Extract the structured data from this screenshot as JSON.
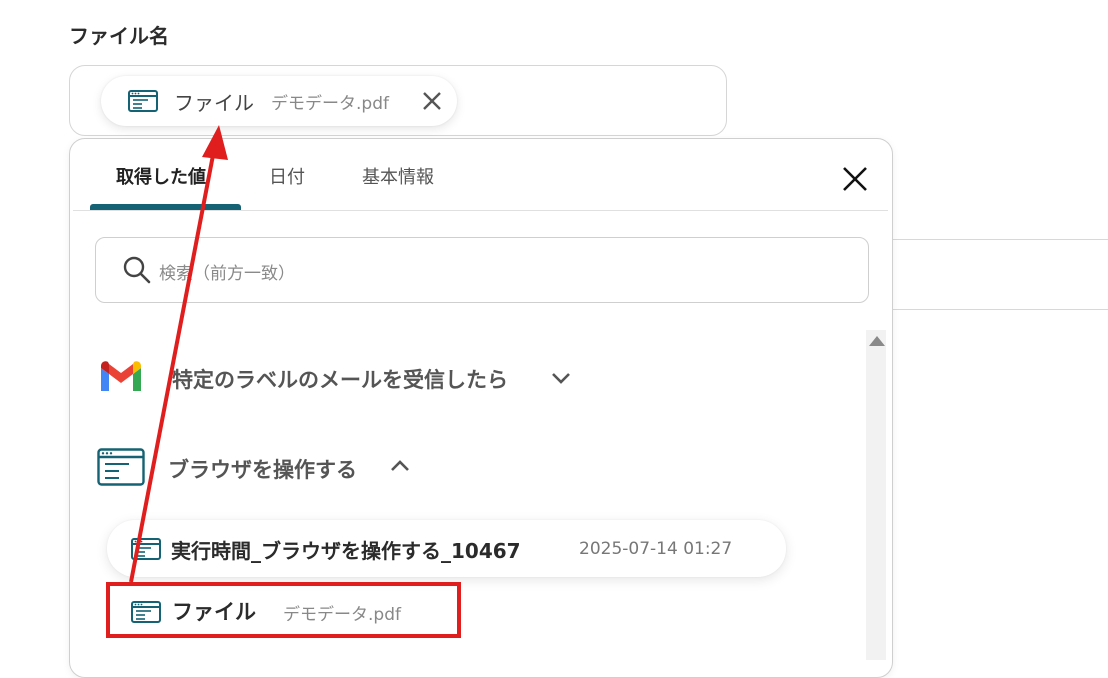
{
  "field": {
    "label": "ファイル名",
    "chip": {
      "label": "ファイル",
      "value": "デモデータ.pdf"
    }
  },
  "popup": {
    "tabs": [
      "取得した値",
      "日付",
      "基本情報"
    ],
    "active_tab": 0,
    "search": {
      "placeholder": "検索（前方一致）"
    },
    "groups": [
      {
        "title": "特定のラベルのメールを受信したら",
        "icon": "gmail-icon",
        "expanded": false
      },
      {
        "title": "ブラウザを操作する",
        "icon": "browser-icon",
        "expanded": true
      }
    ],
    "rows": [
      {
        "title": "実行時間_ブラウザを操作する_10467",
        "date": "2025-07-14 01:27"
      },
      {
        "title": "ファイル",
        "value": "デモデータ.pdf"
      }
    ]
  },
  "colors": {
    "accent": "#146273",
    "highlight": "#e01e1e"
  }
}
